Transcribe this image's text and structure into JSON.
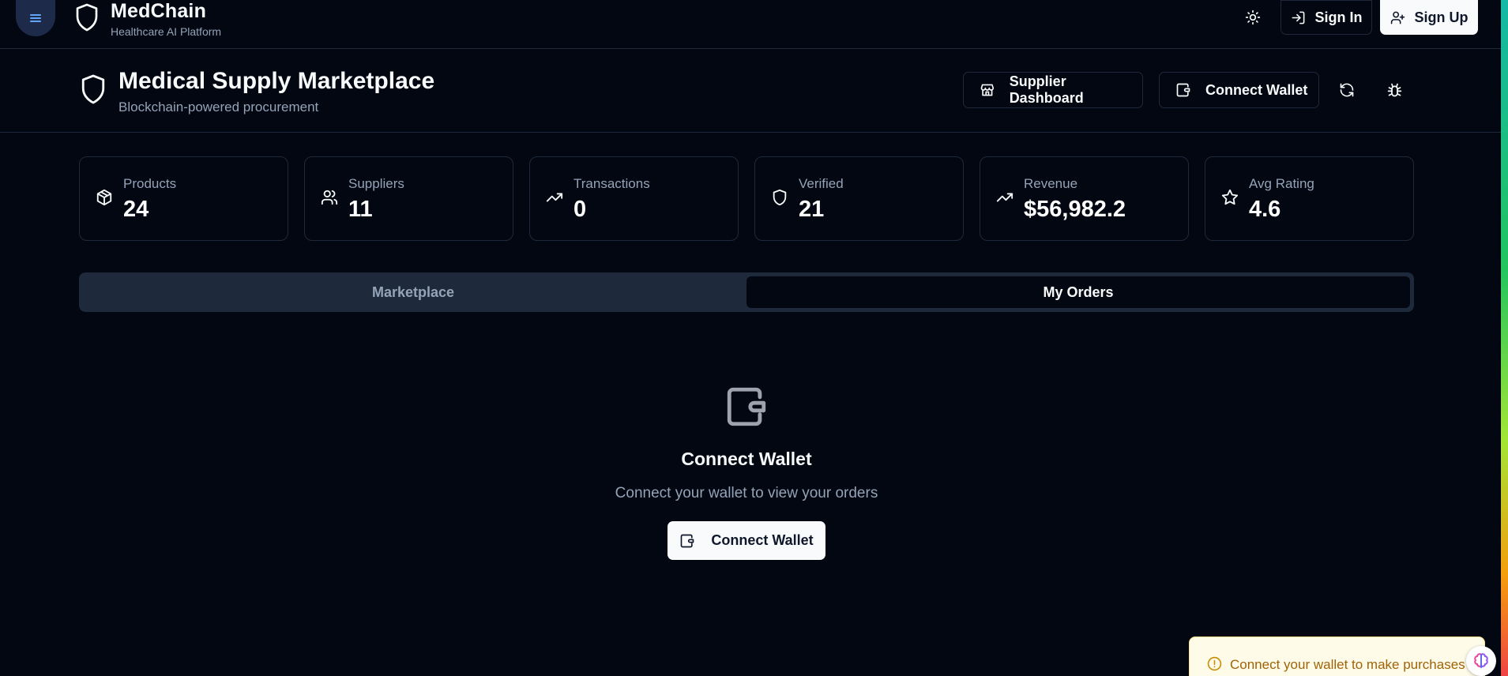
{
  "nav": {
    "brand_name": "MedChain",
    "brand_subtitle": "Healthcare AI Platform",
    "sign_in": "Sign In",
    "sign_up": "Sign Up"
  },
  "header": {
    "title": "Medical Supply Marketplace",
    "subtitle": "Blockchain-powered procurement",
    "supplier_dashboard": "Supplier Dashboard",
    "connect_wallet": "Connect Wallet"
  },
  "stats": [
    {
      "label": "Products",
      "value": "24",
      "icon": "package-icon"
    },
    {
      "label": "Suppliers",
      "value": "11",
      "icon": "users-icon"
    },
    {
      "label": "Transactions",
      "value": "0",
      "icon": "trending-up-icon"
    },
    {
      "label": "Verified",
      "value": "21",
      "icon": "shield-icon"
    },
    {
      "label": "Revenue",
      "value": "$56,982.2",
      "icon": "trending-up-icon"
    },
    {
      "label": "Avg Rating",
      "value": "4.6",
      "icon": "star-icon"
    }
  ],
  "tabs": [
    {
      "label": "Marketplace",
      "active": false
    },
    {
      "label": "My Orders",
      "active": true
    }
  ],
  "empty_state": {
    "title": "Connect Wallet",
    "message": "Connect your wallet to view your orders",
    "button": "Connect Wallet"
  },
  "toast": {
    "message": "Connect your wallet to make purchases"
  },
  "colors": {
    "background": "#030712",
    "border": "#1e293b",
    "muted_text": "#94a3b8",
    "toast_bg": "#fefce8",
    "toast_text": "#a16207",
    "menu_accent": "#60a5fa"
  }
}
